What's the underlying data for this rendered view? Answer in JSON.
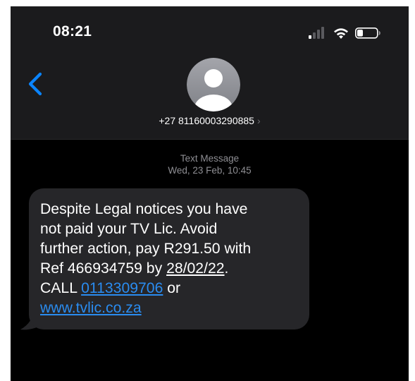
{
  "status_bar": {
    "time": "08:21",
    "icons": [
      "cellular-signal-icon",
      "wifi-icon",
      "battery-icon"
    ]
  },
  "header": {
    "back_icon": "chevron-left-icon",
    "avatar_icon": "person-silhouette-icon",
    "contact_number": "+27 81160003290885",
    "contact_chevron": "›"
  },
  "message_meta": {
    "type": "Text Message",
    "timestamp": "Wed, 23 Feb, 10:45"
  },
  "message": {
    "line1": "Despite Legal notices you have",
    "line2": "not paid your TV Lic. Avoid",
    "line3": "further action, pay R291.50 with",
    "line4_prefix": "Ref 466934759 by ",
    "line4_date": "28/02/22",
    "line4_suffix": ".",
    "line5_prefix": "CALL ",
    "line5_phone": "0113309706",
    "line5_suffix": " or",
    "line6_url": "www.tvlic.co.za"
  },
  "colors": {
    "background": "#000000",
    "header": "#1b1b1d",
    "bubble": "#262629",
    "link": "#2a8cf0",
    "accent": "#0a84ff",
    "meta_text": "#8e8e93"
  }
}
